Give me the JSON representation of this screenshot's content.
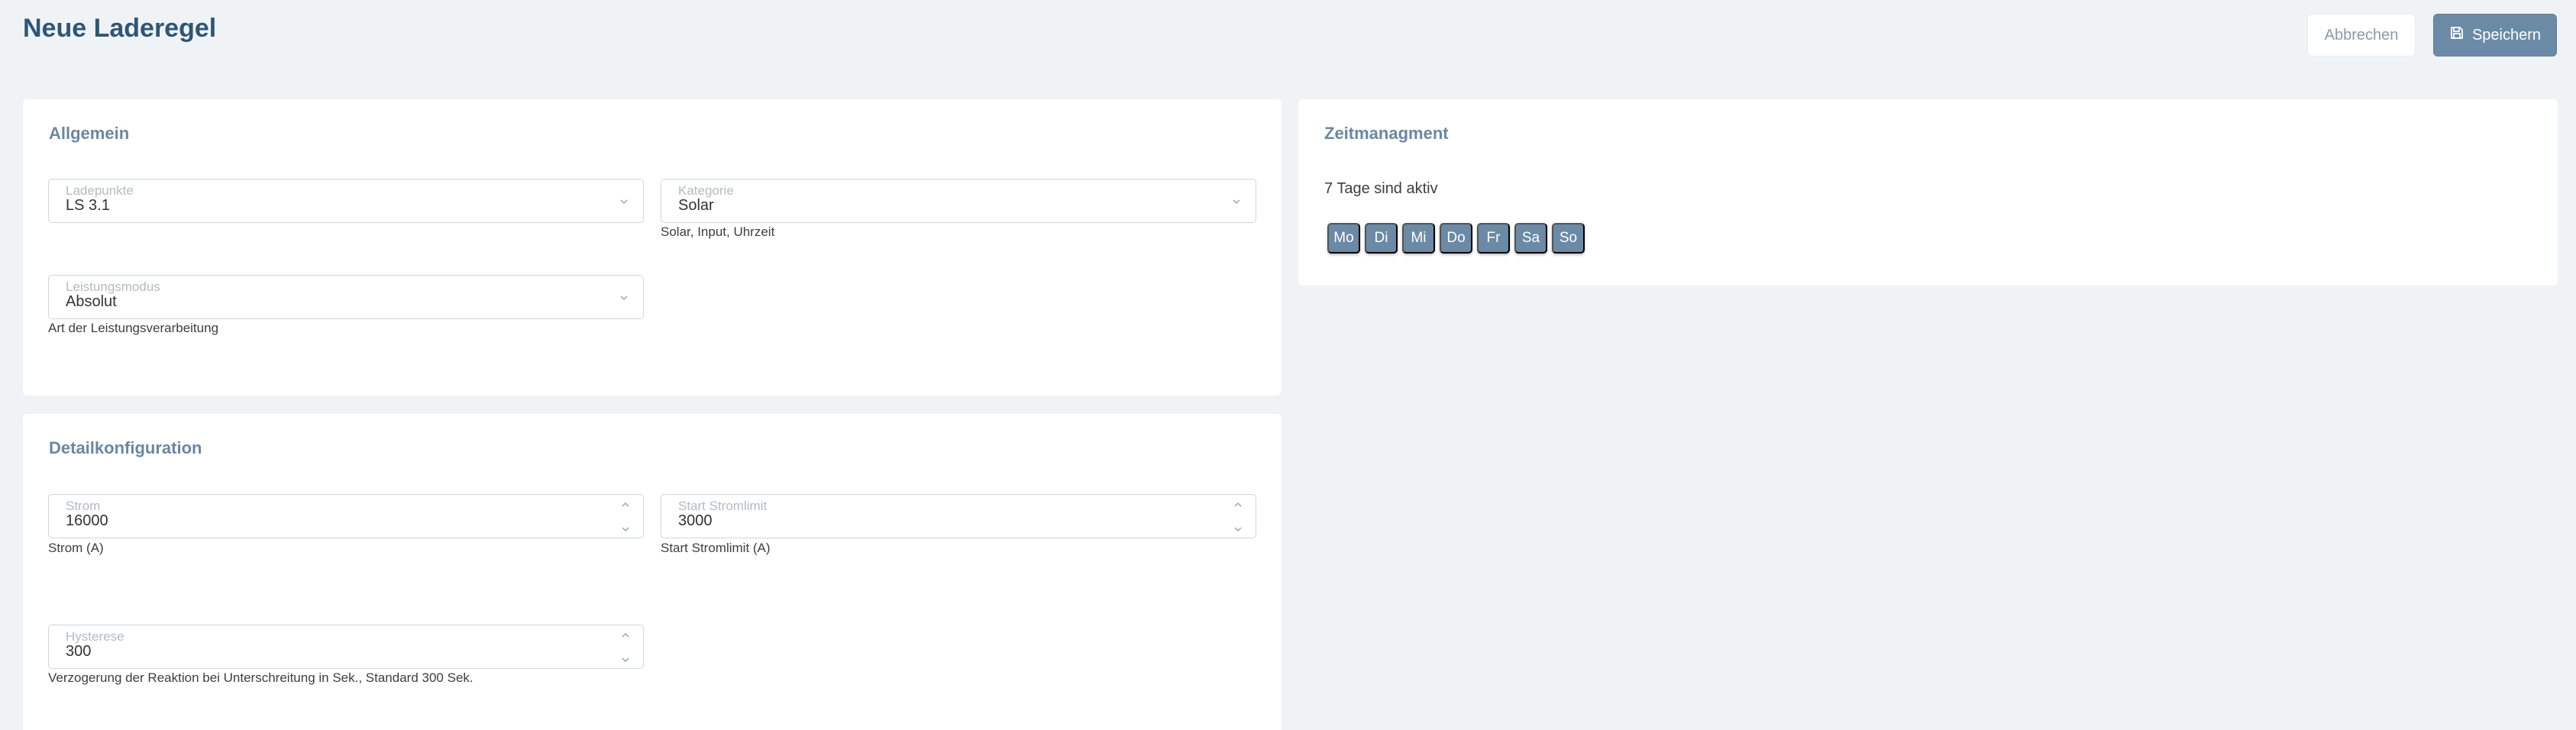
{
  "header": {
    "title": "Neue Laderegel",
    "cancel_label": "Abbrechen",
    "save_label": "Speichern",
    "save_icon": "floppy-disk-icon"
  },
  "general": {
    "title": "Allgemein",
    "chargepoints": {
      "label": "Ladepunkte",
      "value": "LS 3.1"
    },
    "category": {
      "label": "Kategorie",
      "value": "Solar",
      "hint": "Solar, Input, Uhrzeit"
    },
    "power_mode": {
      "label": "Leistungsmodus",
      "value": "Absolut",
      "hint": "Art der Leistungsverarbeitung"
    }
  },
  "detail": {
    "title": "Detailkonfiguration",
    "current": {
      "label": "Strom",
      "value": "16000",
      "hint": "Strom (A)"
    },
    "start_limit": {
      "label": "Start Stromlimit",
      "value": "3000",
      "hint": "Start Stromlimit (A)"
    },
    "hysteresis": {
      "label": "Hysterese",
      "value": "300",
      "hint": "Verzogerung der Reaktion bei Unterschreitung in Sek., Standard 300 Sek."
    }
  },
  "time": {
    "title": "Zeitmanagment",
    "status": "7 Tage sind aktiv",
    "days": [
      "Mo",
      "Di",
      "Mi",
      "Do",
      "Fr",
      "Sa",
      "So"
    ]
  },
  "colors": {
    "accent": "#6b8aa6",
    "title": "#2f5675",
    "background": "#f0f3f6"
  }
}
